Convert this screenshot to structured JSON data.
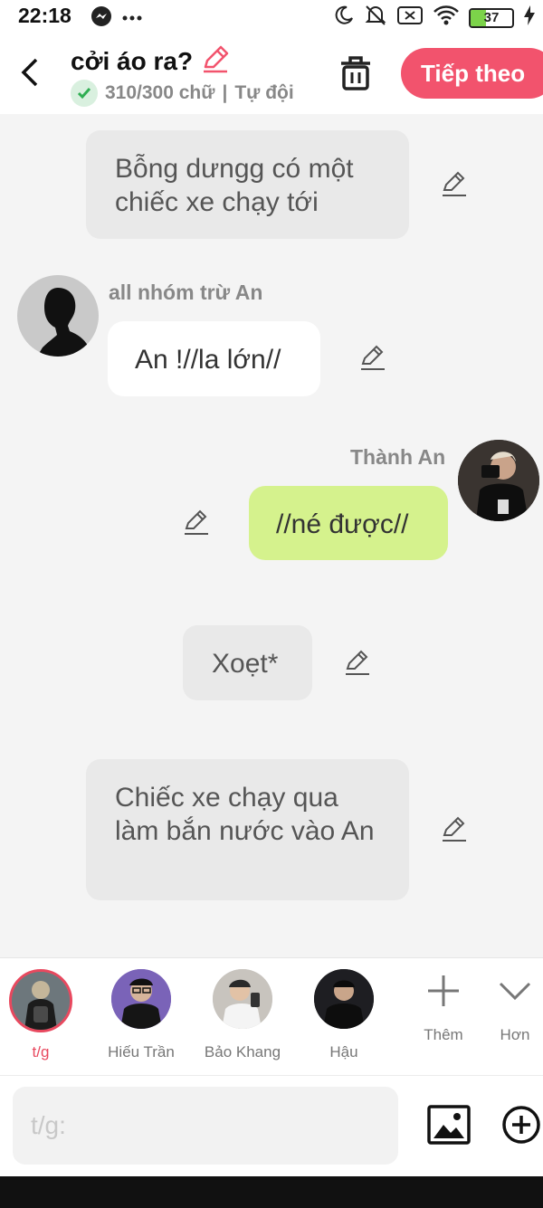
{
  "status_bar": {
    "time": "22:18",
    "battery": "37",
    "icons": [
      "messenger-icon",
      "more-icon",
      "moon-icon",
      "bell-off-icon",
      "sim-x-icon",
      "wifi-icon",
      "battery-icon",
      "charging-icon"
    ]
  },
  "header": {
    "title": "cởi áo ra?",
    "word_count": "310/300 chữ",
    "separator": "|",
    "mode": "Tự đội",
    "next_label": "Tiếp theo"
  },
  "chat": {
    "messages": [
      {
        "type": "narration",
        "text": "Bỗng dưngg có một chiếc xe chạy tới"
      },
      {
        "type": "left",
        "sender": "all nhóm trừ An",
        "text": "An !//la lớn//"
      },
      {
        "type": "right",
        "sender": "Thành An",
        "text": "//né được//"
      },
      {
        "type": "narration",
        "text": "Xoẹt*"
      },
      {
        "type": "narration",
        "text": "Chiếc xe chạy qua làm bắn nước vào An"
      }
    ]
  },
  "characters": {
    "items": [
      {
        "name": "t/g",
        "active": true
      },
      {
        "name": "Hiếu Trần",
        "active": false
      },
      {
        "name": "Bảo Khang",
        "active": false
      },
      {
        "name": "Hậu",
        "active": false
      }
    ],
    "add_label": "Thêm",
    "more_label": "Hơn"
  },
  "input": {
    "placeholder": "t/g:",
    "value": ""
  },
  "colors": {
    "accent": "#f2536d",
    "right_bubble": "#d5f28d",
    "narration_bubble": "#e9e9e9"
  }
}
